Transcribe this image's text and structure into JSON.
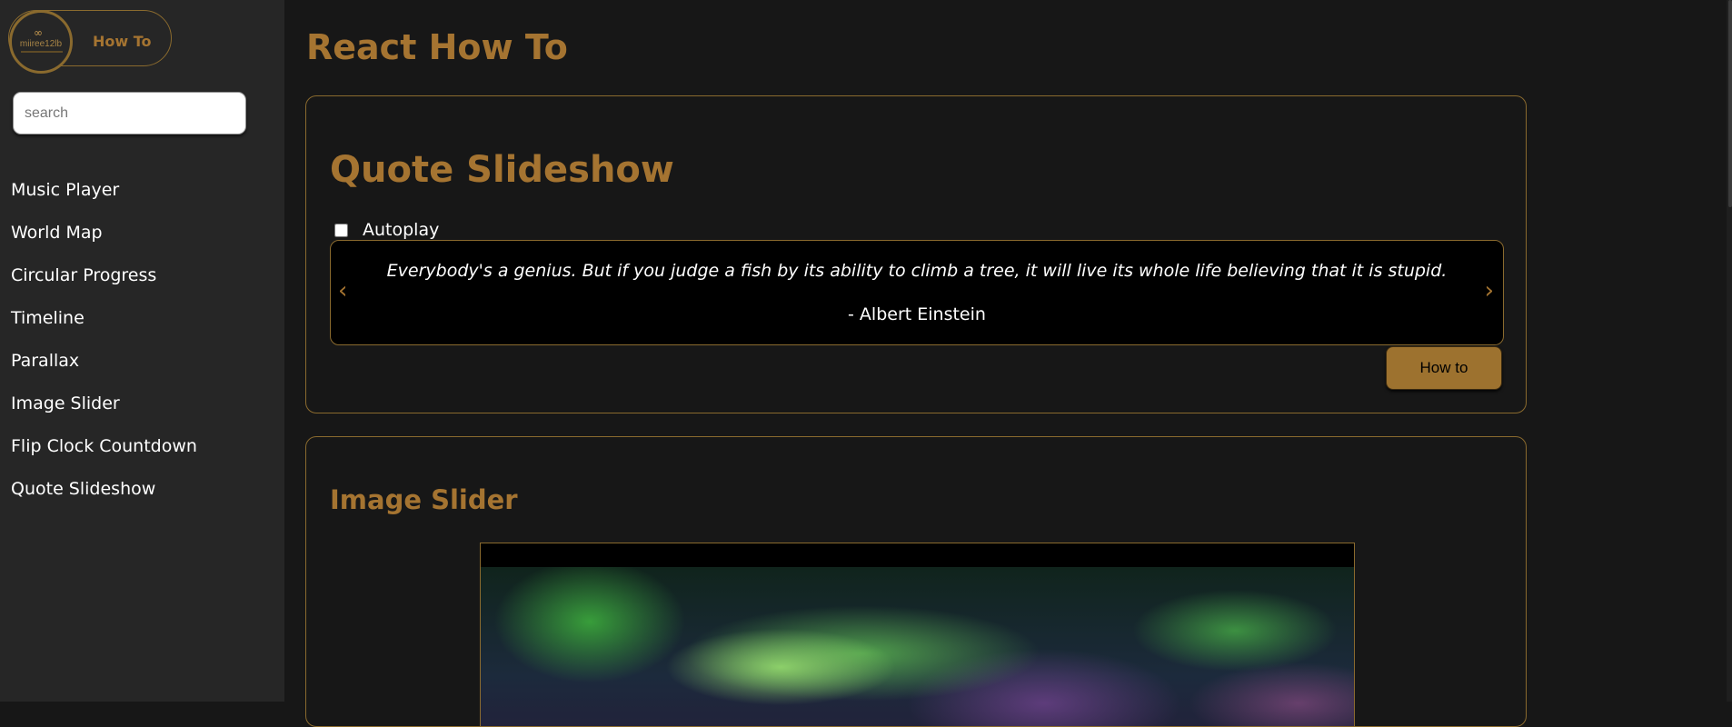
{
  "sidebar": {
    "logo_brand": "miiree12lb",
    "logo_title": "How To",
    "search_placeholder": "search",
    "items": [
      {
        "label": "Music Player"
      },
      {
        "label": "World Map"
      },
      {
        "label": "Circular Progress"
      },
      {
        "label": "Timeline"
      },
      {
        "label": "Parallax"
      },
      {
        "label": "Image Slider"
      },
      {
        "label": "Flip Clock Countdown"
      },
      {
        "label": "Quote Slideshow"
      }
    ]
  },
  "main": {
    "page_title": "React How To",
    "quote_section": {
      "title": "Quote Slideshow",
      "autoplay_label": "Autoplay",
      "autoplay_checked": false,
      "quote": "Everybody's a genius. But if you judge a fish by its ability to climb a tree, it will live its whole life believing that it is stupid.",
      "author": "- Albert Einstein",
      "prev_arrow": "‹",
      "next_arrow": "›",
      "button_label": "How to"
    },
    "image_slider_section": {
      "title": "Image Slider",
      "image": "aurora-borealis-night-sky"
    }
  },
  "colors": {
    "accent": "#a57431",
    "background": "#171717",
    "sidebar": "#262626",
    "button": "#9d722f"
  }
}
